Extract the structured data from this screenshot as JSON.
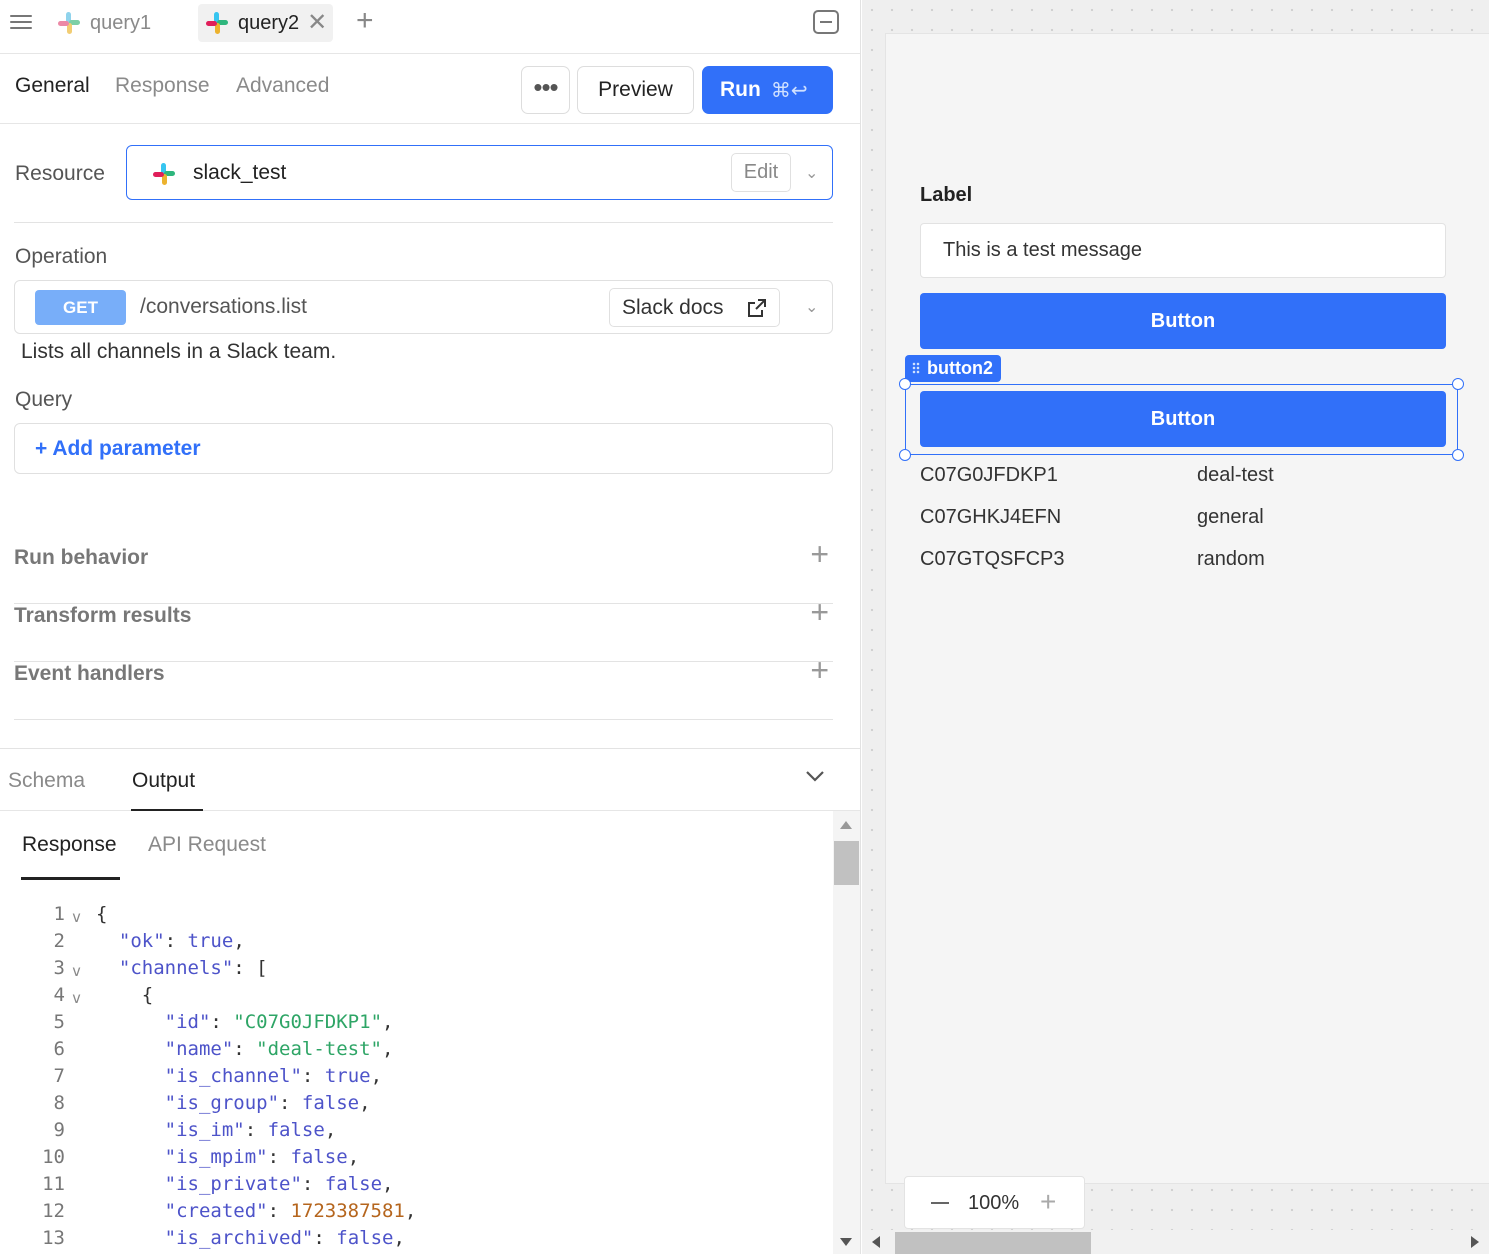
{
  "tabs": [
    {
      "label": "query1",
      "active": false
    },
    {
      "label": "query2",
      "active": true
    }
  ],
  "subtabs": [
    "General",
    "Response",
    "Advanced"
  ],
  "toolbar": {
    "more": "•••",
    "preview": "Preview",
    "run": "Run",
    "run_shortcut": "⌘↩"
  },
  "resource": {
    "label": "Resource",
    "value": "slack_test",
    "edit": "Edit"
  },
  "operation": {
    "label": "Operation",
    "method": "GET",
    "path": "/conversations.list",
    "docs": "Slack docs",
    "description": "Lists all channels in a Slack team."
  },
  "query": {
    "label": "Query",
    "add_parameter": "+ Add parameter"
  },
  "sections": [
    "Run behavior",
    "Transform results",
    "Event handlers"
  ],
  "bottom": {
    "tabs": [
      "Schema",
      "Output"
    ],
    "active": "Output",
    "output_tabs": [
      "Response",
      "API Request"
    ]
  },
  "code_lines": [
    {
      "n": "1",
      "fold": true
    },
    {
      "n": "2",
      "fold": false
    },
    {
      "n": "3",
      "fold": true
    },
    {
      "n": "4",
      "fold": true
    },
    {
      "n": "5",
      "fold": false
    },
    {
      "n": "6",
      "fold": false
    },
    {
      "n": "7",
      "fold": false
    },
    {
      "n": "8",
      "fold": false
    },
    {
      "n": "9",
      "fold": false
    },
    {
      "n": "10",
      "fold": false
    },
    {
      "n": "11",
      "fold": false
    },
    {
      "n": "12",
      "fold": false
    },
    {
      "n": "13",
      "fold": false
    }
  ],
  "response_json": {
    "ok": "true",
    "id": "\"C07G0JFDKP1\"",
    "name": "\"deal-test\"",
    "is_channel": "true",
    "is_group": "false",
    "is_im": "false",
    "is_mpim": "false",
    "is_private": "false",
    "created": "1723387581",
    "is_archived": "false"
  },
  "canvas": {
    "label": "Label",
    "input_value": "This is a test message",
    "button1": "Button",
    "selected_component": "button2",
    "button2": "Button",
    "rows": [
      {
        "id": "C07G0JFDKP1",
        "name": "deal-test"
      },
      {
        "id": "C07GHKJ4EFN",
        "name": "general"
      },
      {
        "id": "C07GTQSFCP3",
        "name": "random"
      }
    ],
    "zoom": "100%"
  },
  "colors": {
    "accent": "#3170f9",
    "get_badge": "#78aef9",
    "string": "#2ea566",
    "number": "#b5651d",
    "keyword": "#4d53c9"
  },
  "icons": [
    "hamburger-icon",
    "slack-icon",
    "close-icon",
    "plus-icon",
    "collapse-panel-icon",
    "chevron-down-icon",
    "external-link-icon",
    "drag-grip-icon",
    "minus-icon"
  ]
}
